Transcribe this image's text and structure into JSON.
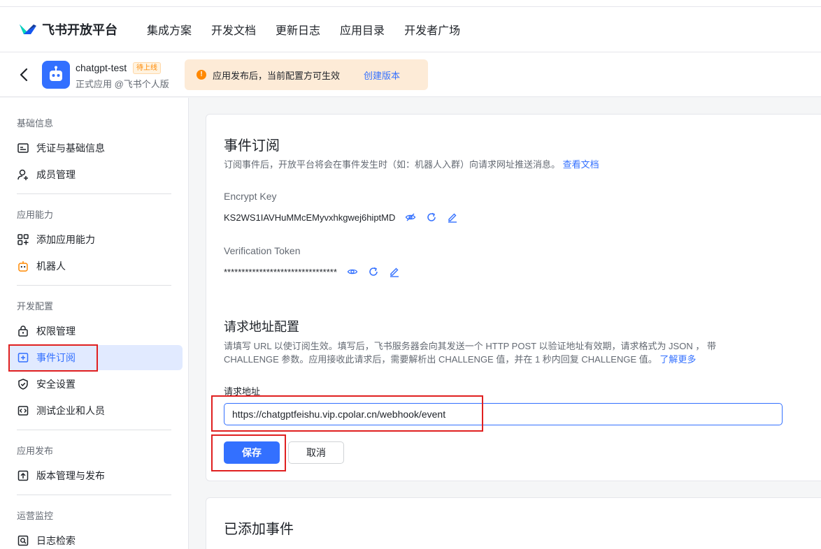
{
  "header": {
    "logo_text": "飞书开放平台",
    "nav": [
      "集成方案",
      "开发文档",
      "更新日志",
      "应用目录",
      "开发者广场"
    ]
  },
  "app": {
    "name": "chatgpt-test",
    "badge": "待上线",
    "subtitle": "正式应用 @飞书个人版",
    "notice_text": "应用发布后，当前配置方可生效",
    "notice_link": "创建版本"
  },
  "sidebar": {
    "groups": [
      "基础信息",
      "应用能力",
      "开发配置",
      "应用发布",
      "运营监控"
    ],
    "items": [
      {
        "label": "凭证与基础信息",
        "icon": "id-card-icon"
      },
      {
        "label": "成员管理",
        "icon": "user-add-icon"
      },
      {
        "label": "添加应用能力",
        "icon": "grid-add-icon"
      },
      {
        "label": "机器人",
        "icon": "robot-icon"
      },
      {
        "label": "权限管理",
        "icon": "lock-icon"
      },
      {
        "label": "事件订阅",
        "icon": "subscribe-icon",
        "active": true
      },
      {
        "label": "安全设置",
        "icon": "shield-icon"
      },
      {
        "label": "测试企业和人员",
        "icon": "code-icon"
      },
      {
        "label": "版本管理与发布",
        "icon": "upload-icon"
      },
      {
        "label": "日志检索",
        "icon": "log-search-icon"
      }
    ]
  },
  "event": {
    "title": "事件订阅",
    "desc": "订阅事件后，开放平台将会在事件发生时（如：机器人入群）向请求网址推送消息。",
    "desc_link": "查看文档",
    "encrypt_label": "Encrypt Key",
    "encrypt_value": "KS2WS1IAVHuMMcEMyvxhkgwej6hiptMD",
    "token_label": "Verification Token",
    "token_value": "********************************"
  },
  "request": {
    "title": "请求地址配置",
    "desc_line1": "请填写 URL 以使订阅生效。填写后，飞书服务器会向其发送一个 HTTP POST 以验证地址有效期，请求格式为 JSON ， 带",
    "desc_line2": "CHALLENGE 参数。应用接收此请求后，需要解析出 CHALLENGE 值，并在 1 秒内回复 CHALLENGE 值。",
    "desc_link": "了解更多",
    "input_label": "请求地址",
    "url_value": "https://chatgptfeishu.vip.cpolar.cn/webhook/event",
    "save_label": "保存",
    "cancel_label": "取消"
  },
  "added": {
    "title": "已添加事件"
  },
  "colors": {
    "primary": "#3370ff",
    "highlight": "#e02020",
    "warning": "#ff8800"
  }
}
